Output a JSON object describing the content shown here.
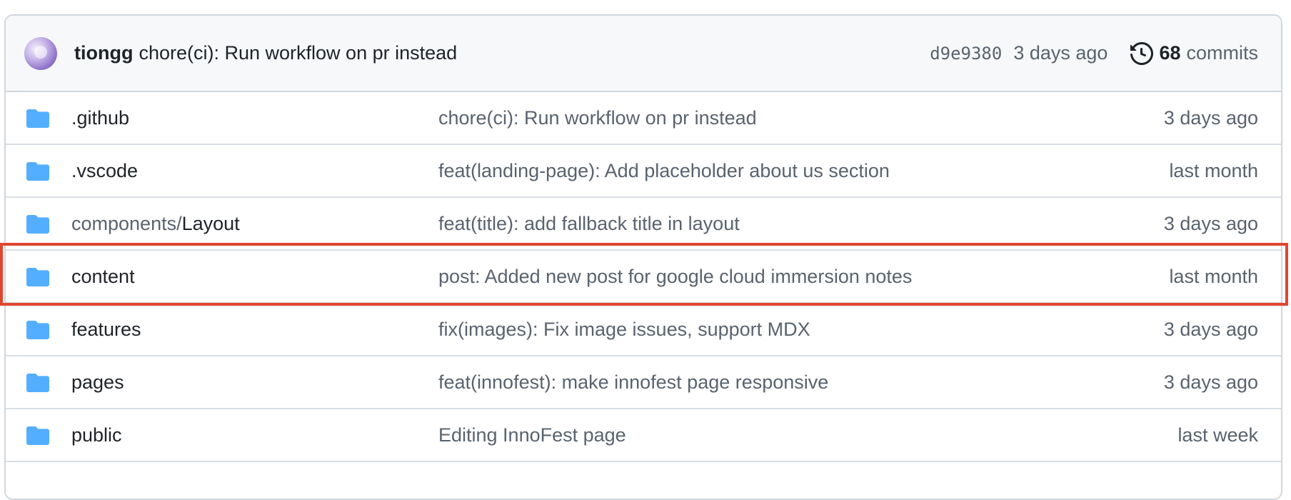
{
  "latest_commit": {
    "author": "tiongg",
    "message": "chore(ci): Run workflow on pr instead",
    "sha": "d9e9380",
    "time": "3 days ago",
    "commit_count": "68",
    "commit_word": "commits",
    "avatar_icon": "user-avatar",
    "history_icon": "history-icon"
  },
  "files": [
    {
      "name_prefix": ".github",
      "name_suffix": "",
      "message": "chore(ci): Run workflow on pr instead",
      "time": "3 days ago",
      "icon": "folder-icon"
    },
    {
      "name_prefix": ".vscode",
      "name_suffix": "",
      "message": "feat(landing-page): Add placeholder about us section",
      "time": "last month",
      "icon": "folder-icon"
    },
    {
      "name_prefix": "components/",
      "name_suffix": "Layout",
      "message": "feat(title): add fallback title in layout",
      "time": "3 days ago",
      "icon": "folder-icon"
    },
    {
      "name_prefix": "content",
      "name_suffix": "",
      "message": "post: Added new post for google cloud immersion notes",
      "time": "last month",
      "icon": "folder-icon"
    },
    {
      "name_prefix": "features",
      "name_suffix": "",
      "message": "fix(images): Fix image issues, support MDX",
      "time": "3 days ago",
      "icon": "folder-icon"
    },
    {
      "name_prefix": "pages",
      "name_suffix": "",
      "message": "feat(innofest): make innofest page responsive",
      "time": "3 days ago",
      "icon": "folder-icon"
    },
    {
      "name_prefix": "public",
      "name_suffix": "",
      "message": "Editing InnoFest page",
      "time": "last week",
      "icon": "folder-icon"
    }
  ],
  "colors": {
    "folder": "#54aeff",
    "highlight": "#e0462f",
    "border": "#d0d7de"
  }
}
